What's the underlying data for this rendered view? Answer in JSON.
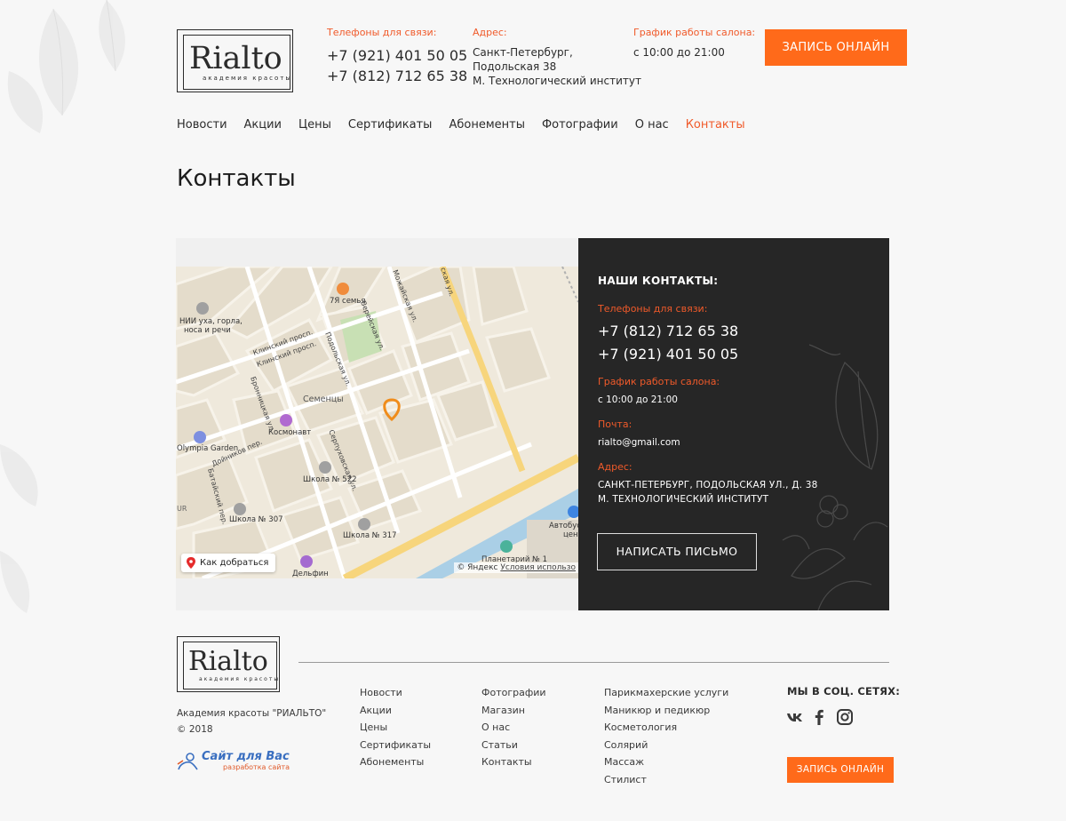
{
  "brand": {
    "name": "Rialto",
    "tagline": "академия красоты"
  },
  "header": {
    "phones_label": "Телефоны для связи:",
    "phones": [
      "+7 (921) 401 50 05",
      "+7 (812) 712 65 38"
    ],
    "address_label": "Адрес:",
    "address_lines": [
      "Санкт-Петербург,",
      "Подольская 38",
      "М. Технологический институт"
    ],
    "hours_label": "График работы салона:",
    "hours": "с 10:00 до 21:00",
    "cta": "ЗАПИСЬ ОНЛАЙН"
  },
  "nav": [
    {
      "label": "Новости",
      "active": false
    },
    {
      "label": "Акции",
      "active": false
    },
    {
      "label": "Цены",
      "active": false
    },
    {
      "label": "Сертификаты",
      "active": false
    },
    {
      "label": "Абонементы",
      "active": false
    },
    {
      "label": "Фотографии",
      "active": false
    },
    {
      "label": "О нас",
      "active": false
    },
    {
      "label": "Контакты",
      "active": true
    }
  ],
  "page_title": "Контакты",
  "map": {
    "route_button": "Как добраться",
    "copyright": "© Яндекс",
    "terms": "Условия использо",
    "labels": {
      "poi_nii": "НИИ уха, горла,",
      "poi_nii2": "носа и речи",
      "semya": "7Я семья",
      "semency": "Семенцы",
      "kosmonavt": "Космонавт",
      "olympia": "Olympia Garden",
      "school522": "Школа № 522",
      "school307": "Школа № 307",
      "school317": "Школа № 317",
      "planetarium": "Планетарий № 1",
      "delfin": "Дельфин",
      "avtobus": "Автобус",
      "cen": "цен",
      "klinsky1": "Клинский просп.",
      "klinsky2": "Клинский просп.",
      "bronnitskaya": "Бронницкая ул.",
      "podolskaya": "Подольская ул.",
      "vereiskaya": "Верейская ул.",
      "mozhaiskaya": "Можайская ул.",
      "serpukhovskaya": "Серпуховская ул.",
      "dnikov": "Дойников пер.",
      "batayskiy": "Батайский пер.",
      "kazan": "ская ул.",
      "ur": "UR"
    }
  },
  "contacts": {
    "title": "НАШИ КОНТАКТЫ:",
    "phones_label": "Телефоны для связи:",
    "phones": [
      "+7 (812) 712 65 38",
      "+7 (921) 401 50 05"
    ],
    "hours_label": "График работы салона:",
    "hours": "с 10:00 до 21:00",
    "email_label": "Почта:",
    "email": "rialto@gmail.com",
    "address_label": "Адрес:",
    "address_lines": [
      "САНКТ-ПЕТЕРБУРГ, ПОДОЛЬСКАЯ УЛ., Д. 38",
      "М. ТЕХНОЛОГИЧЕСКИЙ ИНСТИТУТ"
    ],
    "write_button": "НАПИСАТЬ ПИСЬМО"
  },
  "footer": {
    "company": "Академия красоты \"РИАЛЬТО\"",
    "year": "© 2018",
    "col1": [
      "Новости",
      "Акции",
      "Цены",
      "Сертификаты",
      "Абонементы"
    ],
    "col2": [
      "Фотографии",
      "Магазин",
      "О нас",
      "Статьи",
      "Контакты"
    ],
    "col3": [
      "Парикмахерские услуги",
      "Маникюр и педикюр",
      "Косметология",
      "Солярий",
      "Массаж",
      "Стилист"
    ],
    "social_title": "МЫ В СОЦ. СЕТЯХ:",
    "social": [
      "vk-icon",
      "facebook-icon",
      "instagram-icon"
    ],
    "cta": "ЗАПИСЬ ОНЛАЙН",
    "dev_name": "Сайт для Вас",
    "dev_sub": "разработка сайта"
  },
  "colors": {
    "accent": "#f05a2a",
    "button": "#ff6a1a",
    "panel": "#262626",
    "background": "#f7f7f7"
  }
}
